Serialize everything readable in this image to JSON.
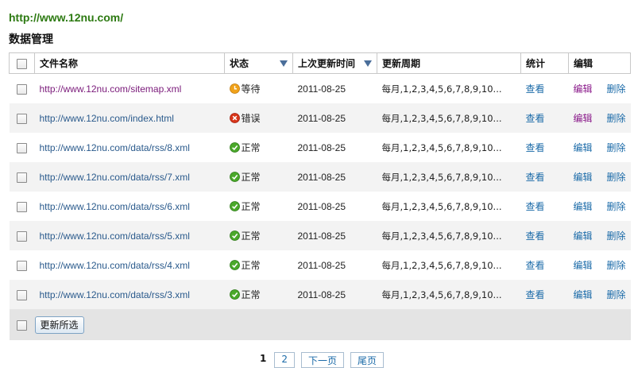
{
  "header": {
    "site_url": "http://www.12nu.com/",
    "section_title": "数据管理"
  },
  "table": {
    "columns": {
      "name": "文件名称",
      "status": "状态",
      "last_update": "上次更新时间",
      "period": "更新周期",
      "stats": "统计",
      "edit": "编辑"
    },
    "rows": [
      {
        "url": "http://www.12nu.com/sitemap.xml",
        "status": "等待",
        "status_type": "waiting",
        "date": "2011-08-25",
        "period": "每月,1,2,3,4,5,6,7,8,9,10...",
        "view": "查看",
        "edit": "编辑",
        "delete": "删除"
      },
      {
        "url": "http://www.12nu.com/index.html",
        "status": "错误",
        "status_type": "error",
        "date": "2011-08-25",
        "period": "每月,1,2,3,4,5,6,7,8,9,10...",
        "view": "查看",
        "edit": "编辑",
        "delete": "删除"
      },
      {
        "url": "http://www.12nu.com/data/rss/8.xml",
        "status": "正常",
        "status_type": "ok",
        "date": "2011-08-25",
        "period": "每月,1,2,3,4,5,6,7,8,9,10...",
        "view": "查看",
        "edit": "编辑",
        "delete": "删除"
      },
      {
        "url": "http://www.12nu.com/data/rss/7.xml",
        "status": "正常",
        "status_type": "ok",
        "date": "2011-08-25",
        "period": "每月,1,2,3,4,5,6,7,8,9,10...",
        "view": "查看",
        "edit": "编辑",
        "delete": "删除"
      },
      {
        "url": "http://www.12nu.com/data/rss/6.xml",
        "status": "正常",
        "status_type": "ok",
        "date": "2011-08-25",
        "period": "每月,1,2,3,4,5,6,7,8,9,10...",
        "view": "查看",
        "edit": "编辑",
        "delete": "删除"
      },
      {
        "url": "http://www.12nu.com/data/rss/5.xml",
        "status": "正常",
        "status_type": "ok",
        "date": "2011-08-25",
        "period": "每月,1,2,3,4,5,6,7,8,9,10...",
        "view": "查看",
        "edit": "编辑",
        "delete": "删除"
      },
      {
        "url": "http://www.12nu.com/data/rss/4.xml",
        "status": "正常",
        "status_type": "ok",
        "date": "2011-08-25",
        "period": "每月,1,2,3,4,5,6,7,8,9,10...",
        "view": "查看",
        "edit": "编辑",
        "delete": "删除"
      },
      {
        "url": "http://www.12nu.com/data/rss/3.xml",
        "status": "正常",
        "status_type": "ok",
        "date": "2011-08-25",
        "period": "每月,1,2,3,4,5,6,7,8,9,10...",
        "view": "查看",
        "edit": "编辑",
        "delete": "删除"
      }
    ],
    "footer": {
      "update_selected": "更新所选"
    }
  },
  "pagination": {
    "current": "1",
    "page2": "2",
    "next": "下一页",
    "last": "尾页"
  },
  "icons": {
    "sort": "sort-down-icon",
    "waiting": "clock-icon",
    "error": "error-icon",
    "ok": "check-icon"
  },
  "colors": {
    "site_url": "#2d7a12",
    "link": "#2a5a8c",
    "visited": "#7a1a7a",
    "ok": "#4aa82a",
    "error": "#d8361a",
    "waiting": "#f0a21a"
  }
}
